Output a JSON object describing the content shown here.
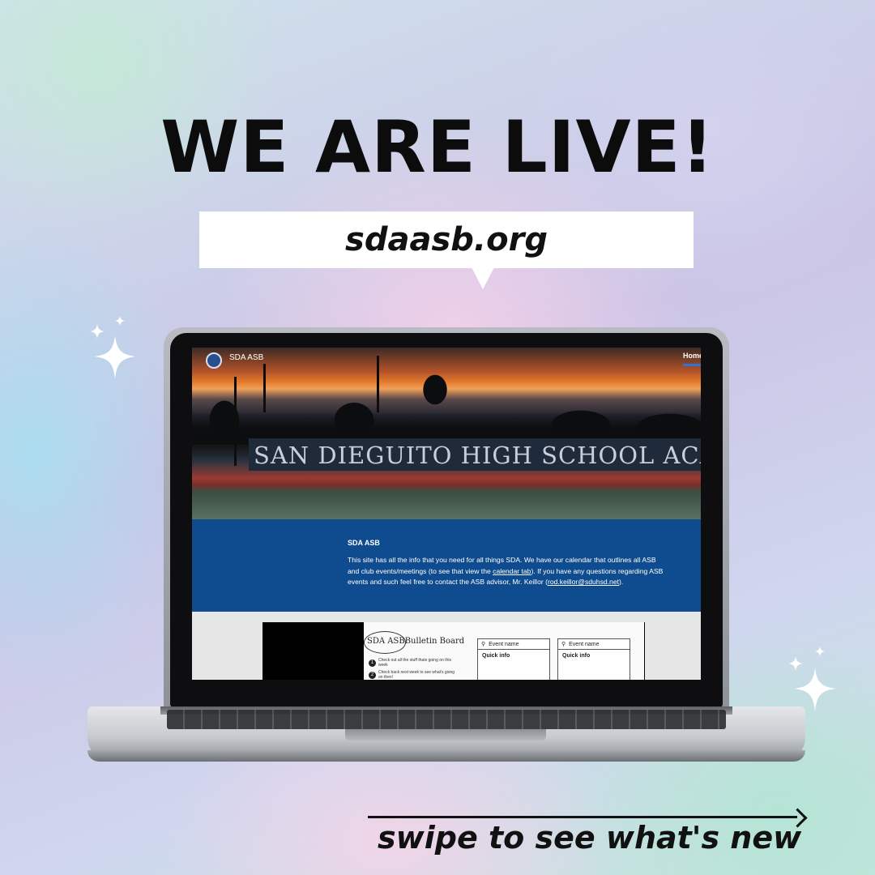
{
  "headline": "WE ARE LIVE!",
  "url": "sdaasb.org",
  "swipe_text": "swipe to see what's new",
  "website": {
    "site_name": "SDA ASB",
    "nav_active": "Home",
    "banner_text": "SAN DIEGUITO HIGH SCHOOL ACA",
    "info_title": "SDA ASB",
    "info_body_1": "This site has all the info that you need for all things SDA. We have our calendar that outlines all ASB and club events/meetings (to see that view the ",
    "info_link_calendar": "calendar tab",
    "info_body_2": "). If you have any questions regarding ASB events and such feel free to contact the ASB advisor, Mr. Keillor (",
    "info_link_email": "rod.keillor@sduhsd.net",
    "info_body_3": ").",
    "bulletin": {
      "title_oval": "SDA ASB",
      "title_rest": "Bulletin Board",
      "items": [
        {
          "num": "1",
          "text": "Check out all the stuff thats going on this week"
        },
        {
          "num": "2",
          "text": "Check back next week to see what's going on then!"
        }
      ],
      "event_cards": [
        {
          "name": "Event name",
          "info": "Quick info"
        },
        {
          "name": "Event name",
          "info": "Quick info"
        }
      ]
    }
  },
  "colors": {
    "info_bg": "#0f4c8f",
    "nav_underline": "#2f72d8",
    "text_dark": "#111111"
  },
  "icons": {
    "sparkle": "sparkle-icon",
    "search": "search-icon",
    "arrow": "arrow-right-icon"
  }
}
